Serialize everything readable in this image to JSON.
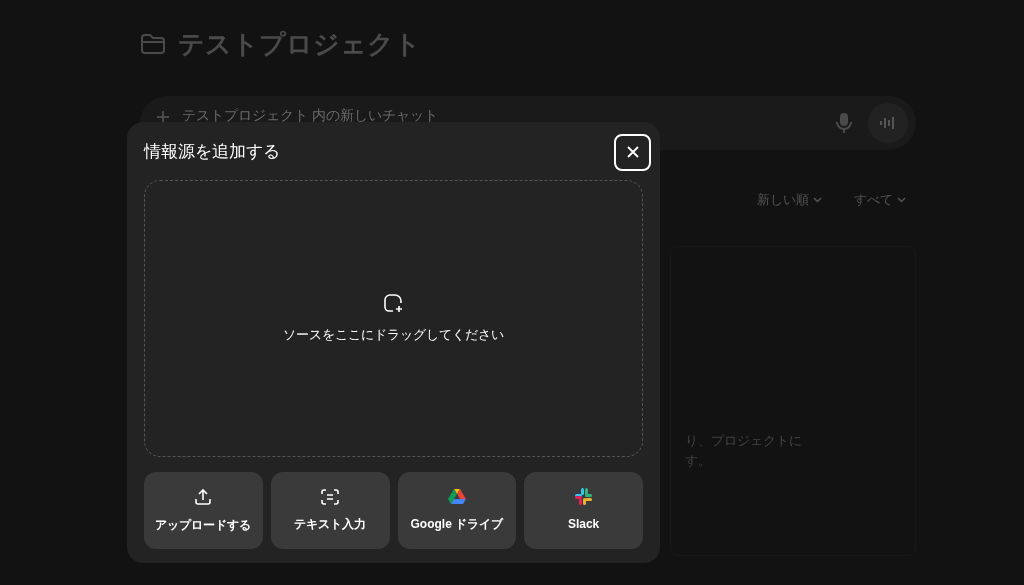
{
  "project": {
    "title": "テストプロジェクト"
  },
  "chat_input": {
    "placeholder": "テストプロジェクト 内の新しいチャット"
  },
  "filters": [
    {
      "label": "新しい順"
    },
    {
      "label": "すべて"
    }
  ],
  "empty_state": {
    "lines": [
      "り、プロジェクトに",
      "す。"
    ]
  },
  "dialog": {
    "title": "情報源を追加する",
    "drop_zone": {
      "text": "ソースをここにドラッグしてください"
    },
    "sources": [
      {
        "kind": "upload",
        "label": "アップロードする"
      },
      {
        "kind": "text",
        "label": "テキスト入力"
      },
      {
        "kind": "drive",
        "label": "Google ドライブ"
      },
      {
        "kind": "slack",
        "label": "Slack"
      }
    ]
  }
}
